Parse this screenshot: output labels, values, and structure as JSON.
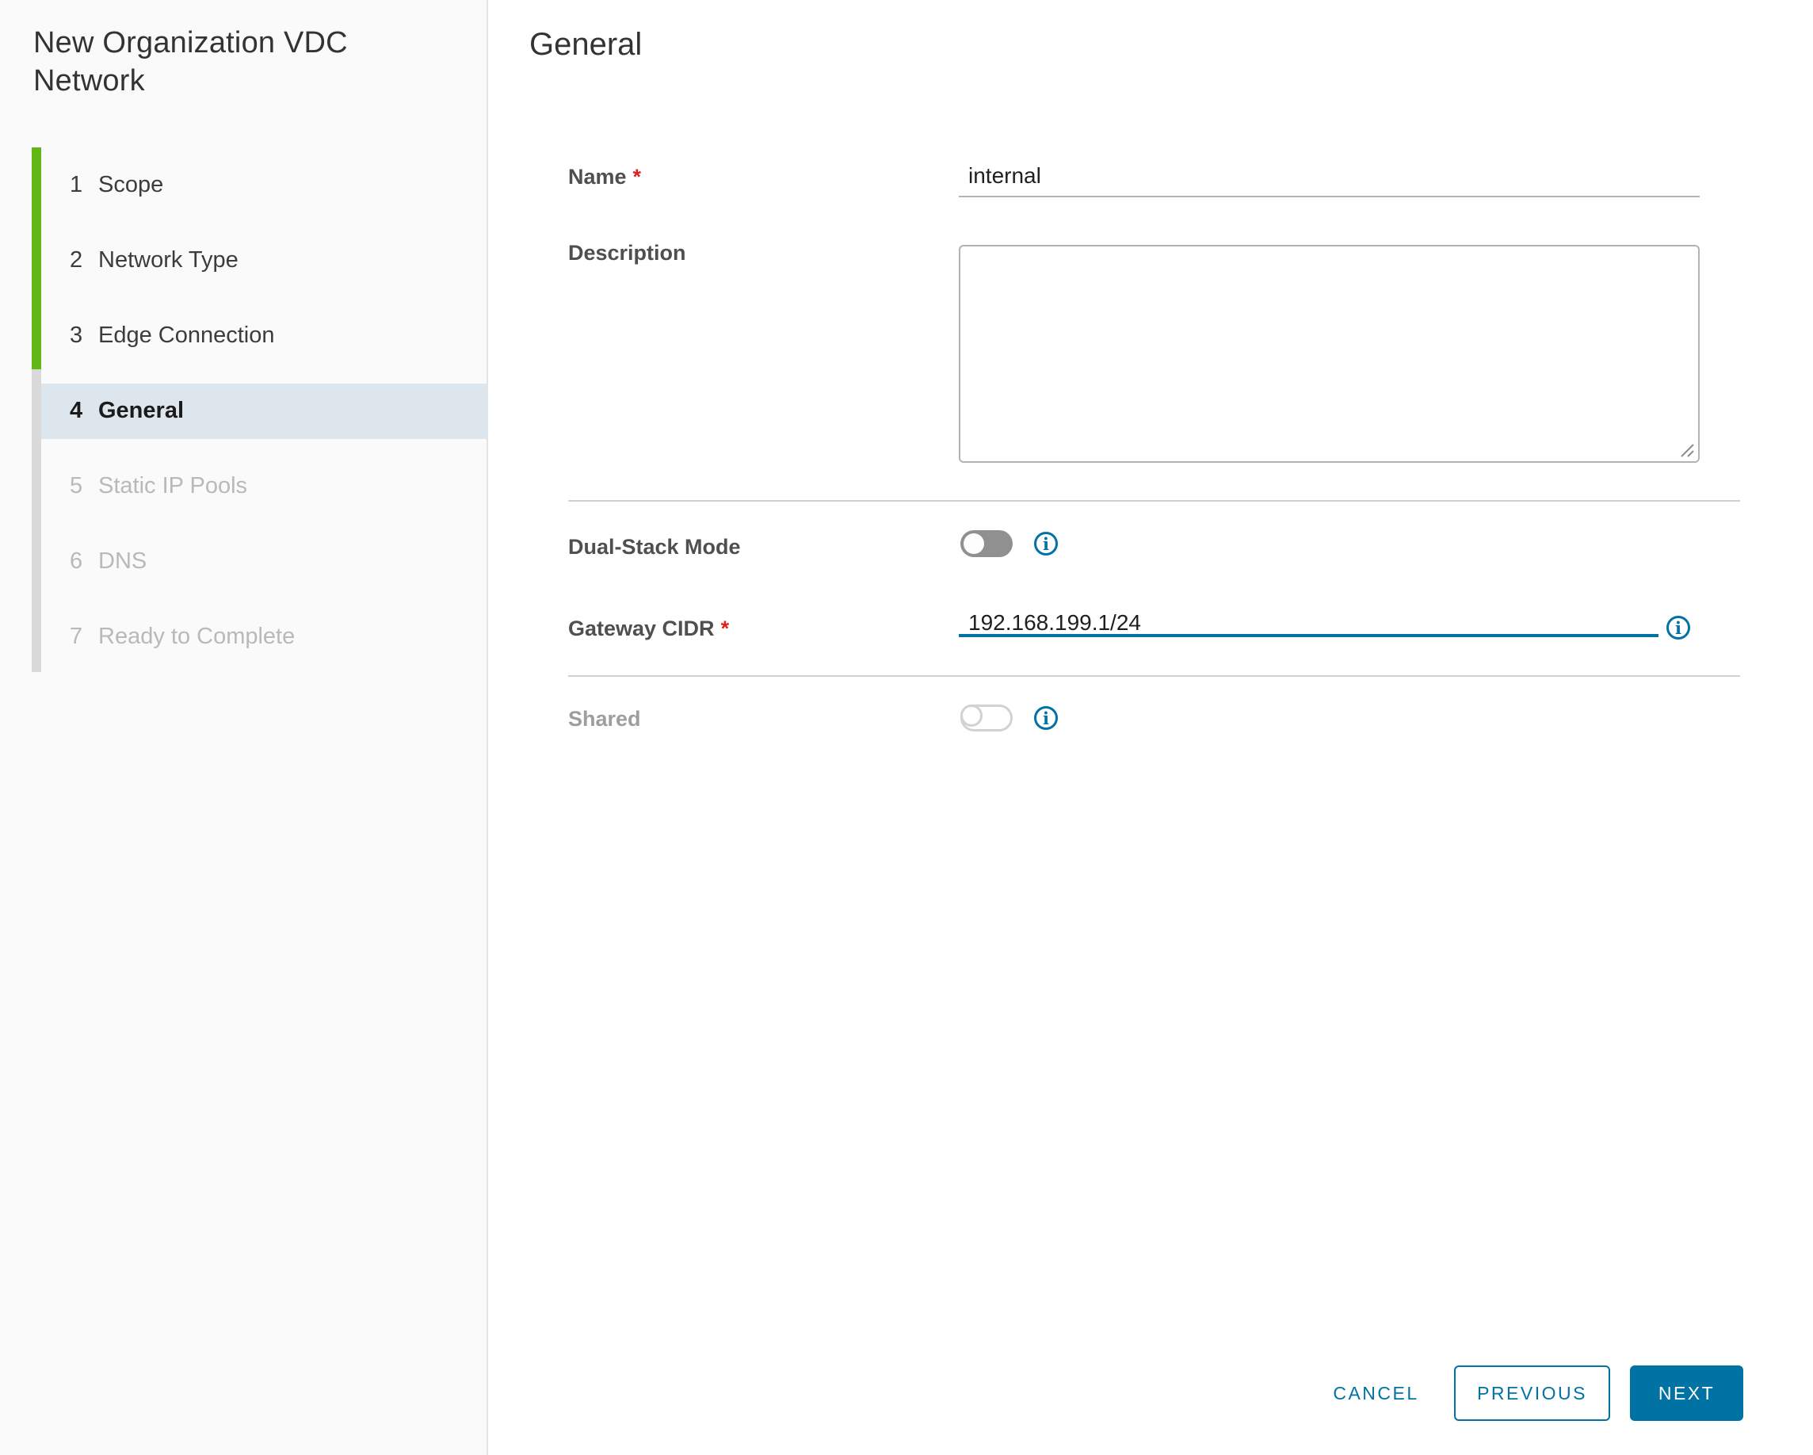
{
  "wizard": {
    "title": "New Organization VDC Network",
    "steps": [
      {
        "num": "1",
        "label": "Scope",
        "state": "complete"
      },
      {
        "num": "2",
        "label": "Network Type",
        "state": "complete"
      },
      {
        "num": "3",
        "label": "Edge Connection",
        "state": "complete"
      },
      {
        "num": "4",
        "label": "General",
        "state": "active"
      },
      {
        "num": "5",
        "label": "Static IP Pools",
        "state": "upcoming"
      },
      {
        "num": "6",
        "label": "DNS",
        "state": "upcoming"
      },
      {
        "num": "7",
        "label": "Ready to Complete",
        "state": "upcoming"
      }
    ]
  },
  "page": {
    "heading": "General"
  },
  "form": {
    "required_marker": "*",
    "name": {
      "label": "Name",
      "required": true,
      "value": "internal"
    },
    "description": {
      "label": "Description",
      "value": ""
    },
    "dual_stack": {
      "label": "Dual-Stack Mode",
      "enabled": false
    },
    "gateway_cidr": {
      "label": "Gateway CIDR",
      "required": true,
      "value": "192.168.199.1/24",
      "focused": true
    },
    "shared": {
      "label": "Shared",
      "enabled": false,
      "disabled": true
    }
  },
  "icons": {
    "info_glyph": "i"
  },
  "footer": {
    "cancel_label": "CANCEL",
    "previous_label": "PREVIOUS",
    "next_label": "NEXT"
  },
  "colors": {
    "accent_blue": "#0072a3",
    "progress_green": "#61b715",
    "active_step_bg": "#dde6ec",
    "required_red": "#e02020"
  }
}
